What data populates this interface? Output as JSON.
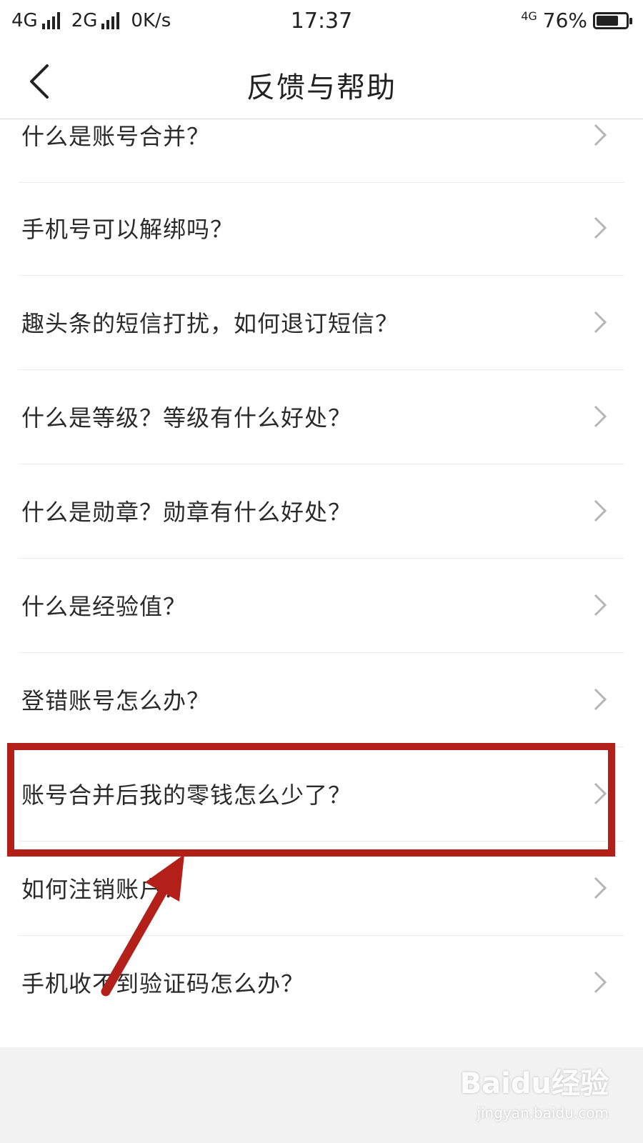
{
  "status_bar": {
    "network_1": "4G",
    "network_2": "2G",
    "speed": "0K/s",
    "time": "17:37",
    "network_small": "4G",
    "battery": "76%",
    "battery_level": 0.76
  },
  "nav": {
    "title": "反馈与帮助"
  },
  "faq_items": [
    "什么是账号合并？",
    "手机号可以解绑吗？",
    "趣头条的短信打扰，如何退订短信？",
    "什么是等级？等级有什么好处？",
    "什么是勋章？勋章有什么好处？",
    "什么是经验值？",
    "登错账号怎么办？",
    "账号合并后我的零钱怎么少了？",
    "如何注销账户？",
    "手机收不到验证码怎么办？"
  ],
  "annotation": {
    "color": "#b3201a"
  },
  "watermark": {
    "main": "Baidu经验",
    "sub": "jingyan.baidu.com"
  }
}
